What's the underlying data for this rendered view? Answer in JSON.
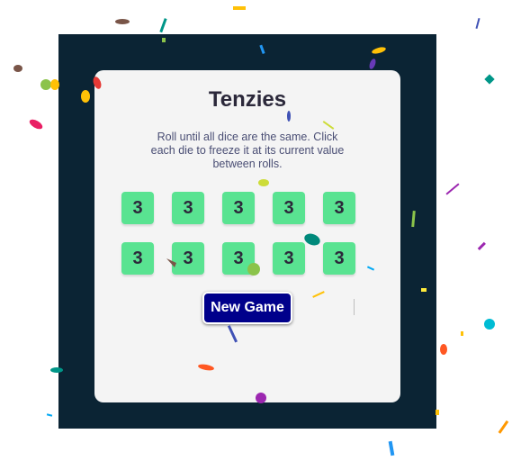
{
  "game": {
    "title": "Tenzies",
    "instructions": "Roll until all dice are the same. Click each die to freeze it at its current value between rolls.",
    "dice": [
      "3",
      "3",
      "3",
      "3",
      "3",
      "3",
      "3",
      "3",
      "3",
      "3"
    ],
    "new_game_label": "New Game"
  },
  "colors": {
    "frame": "#0b2434",
    "card": "#f4f4f4",
    "die_held": "#59e391",
    "button": "#00008b"
  }
}
